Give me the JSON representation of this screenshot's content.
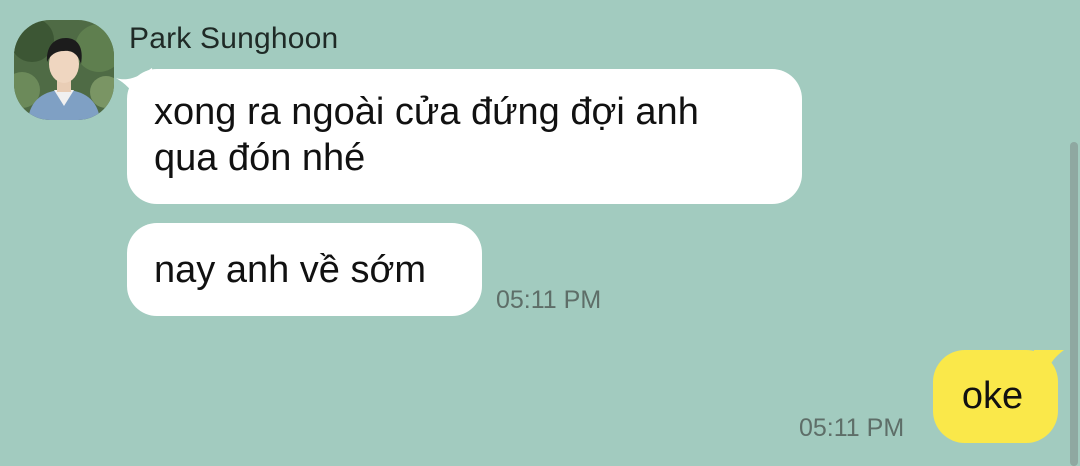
{
  "chat": {
    "sender_name": "Park Sunghoon",
    "avatar_icon": "profile-photo",
    "messages_in": [
      {
        "lines": [
          "xong ra ngoài cửa đứng đợi anh",
          "qua đón nhé"
        ]
      },
      {
        "text": "nay anh về sớm",
        "time": "05:11 PM"
      }
    ],
    "messages_out": [
      {
        "text": "oke",
        "time": "05:11 PM"
      }
    ]
  },
  "colors": {
    "background": "#a2cbbf",
    "incoming_bubble": "#ffffff",
    "outgoing_bubble": "#fae84a",
    "timestamp": "#5e6e68"
  }
}
